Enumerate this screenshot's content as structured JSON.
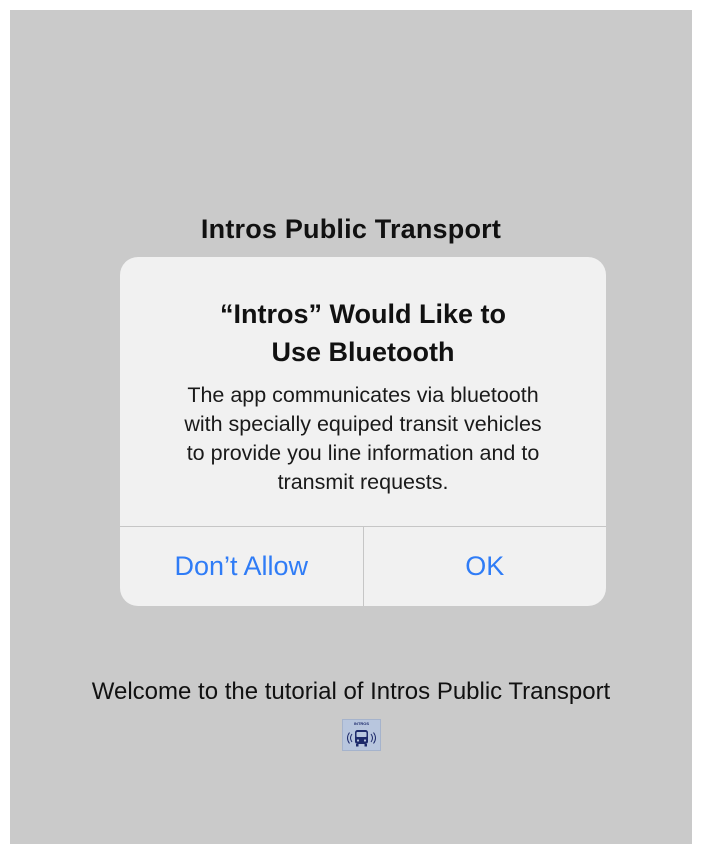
{
  "screen": {
    "app_title": "Intros Public Transport",
    "welcome_text": "Welcome to the tutorial of Intros Public Transport",
    "logo": {
      "text": "INTROS",
      "icon": "bus-bluetooth-icon"
    }
  },
  "alert": {
    "title_line1": "“Intros” Would Like to",
    "title_line2": "Use Bluetooth",
    "message_line1": "The app communicates via bluetooth",
    "message_line2": "with specially equiped transit vehicles",
    "message_line3": "to provide you line information and to",
    "message_line4": "transmit requests.",
    "buttons": {
      "deny": "Don’t Allow",
      "ok": "OK"
    }
  },
  "colors": {
    "background": "#cacaca",
    "alert_background": "#f1f1f1",
    "button_text": "#2f7cf6"
  }
}
